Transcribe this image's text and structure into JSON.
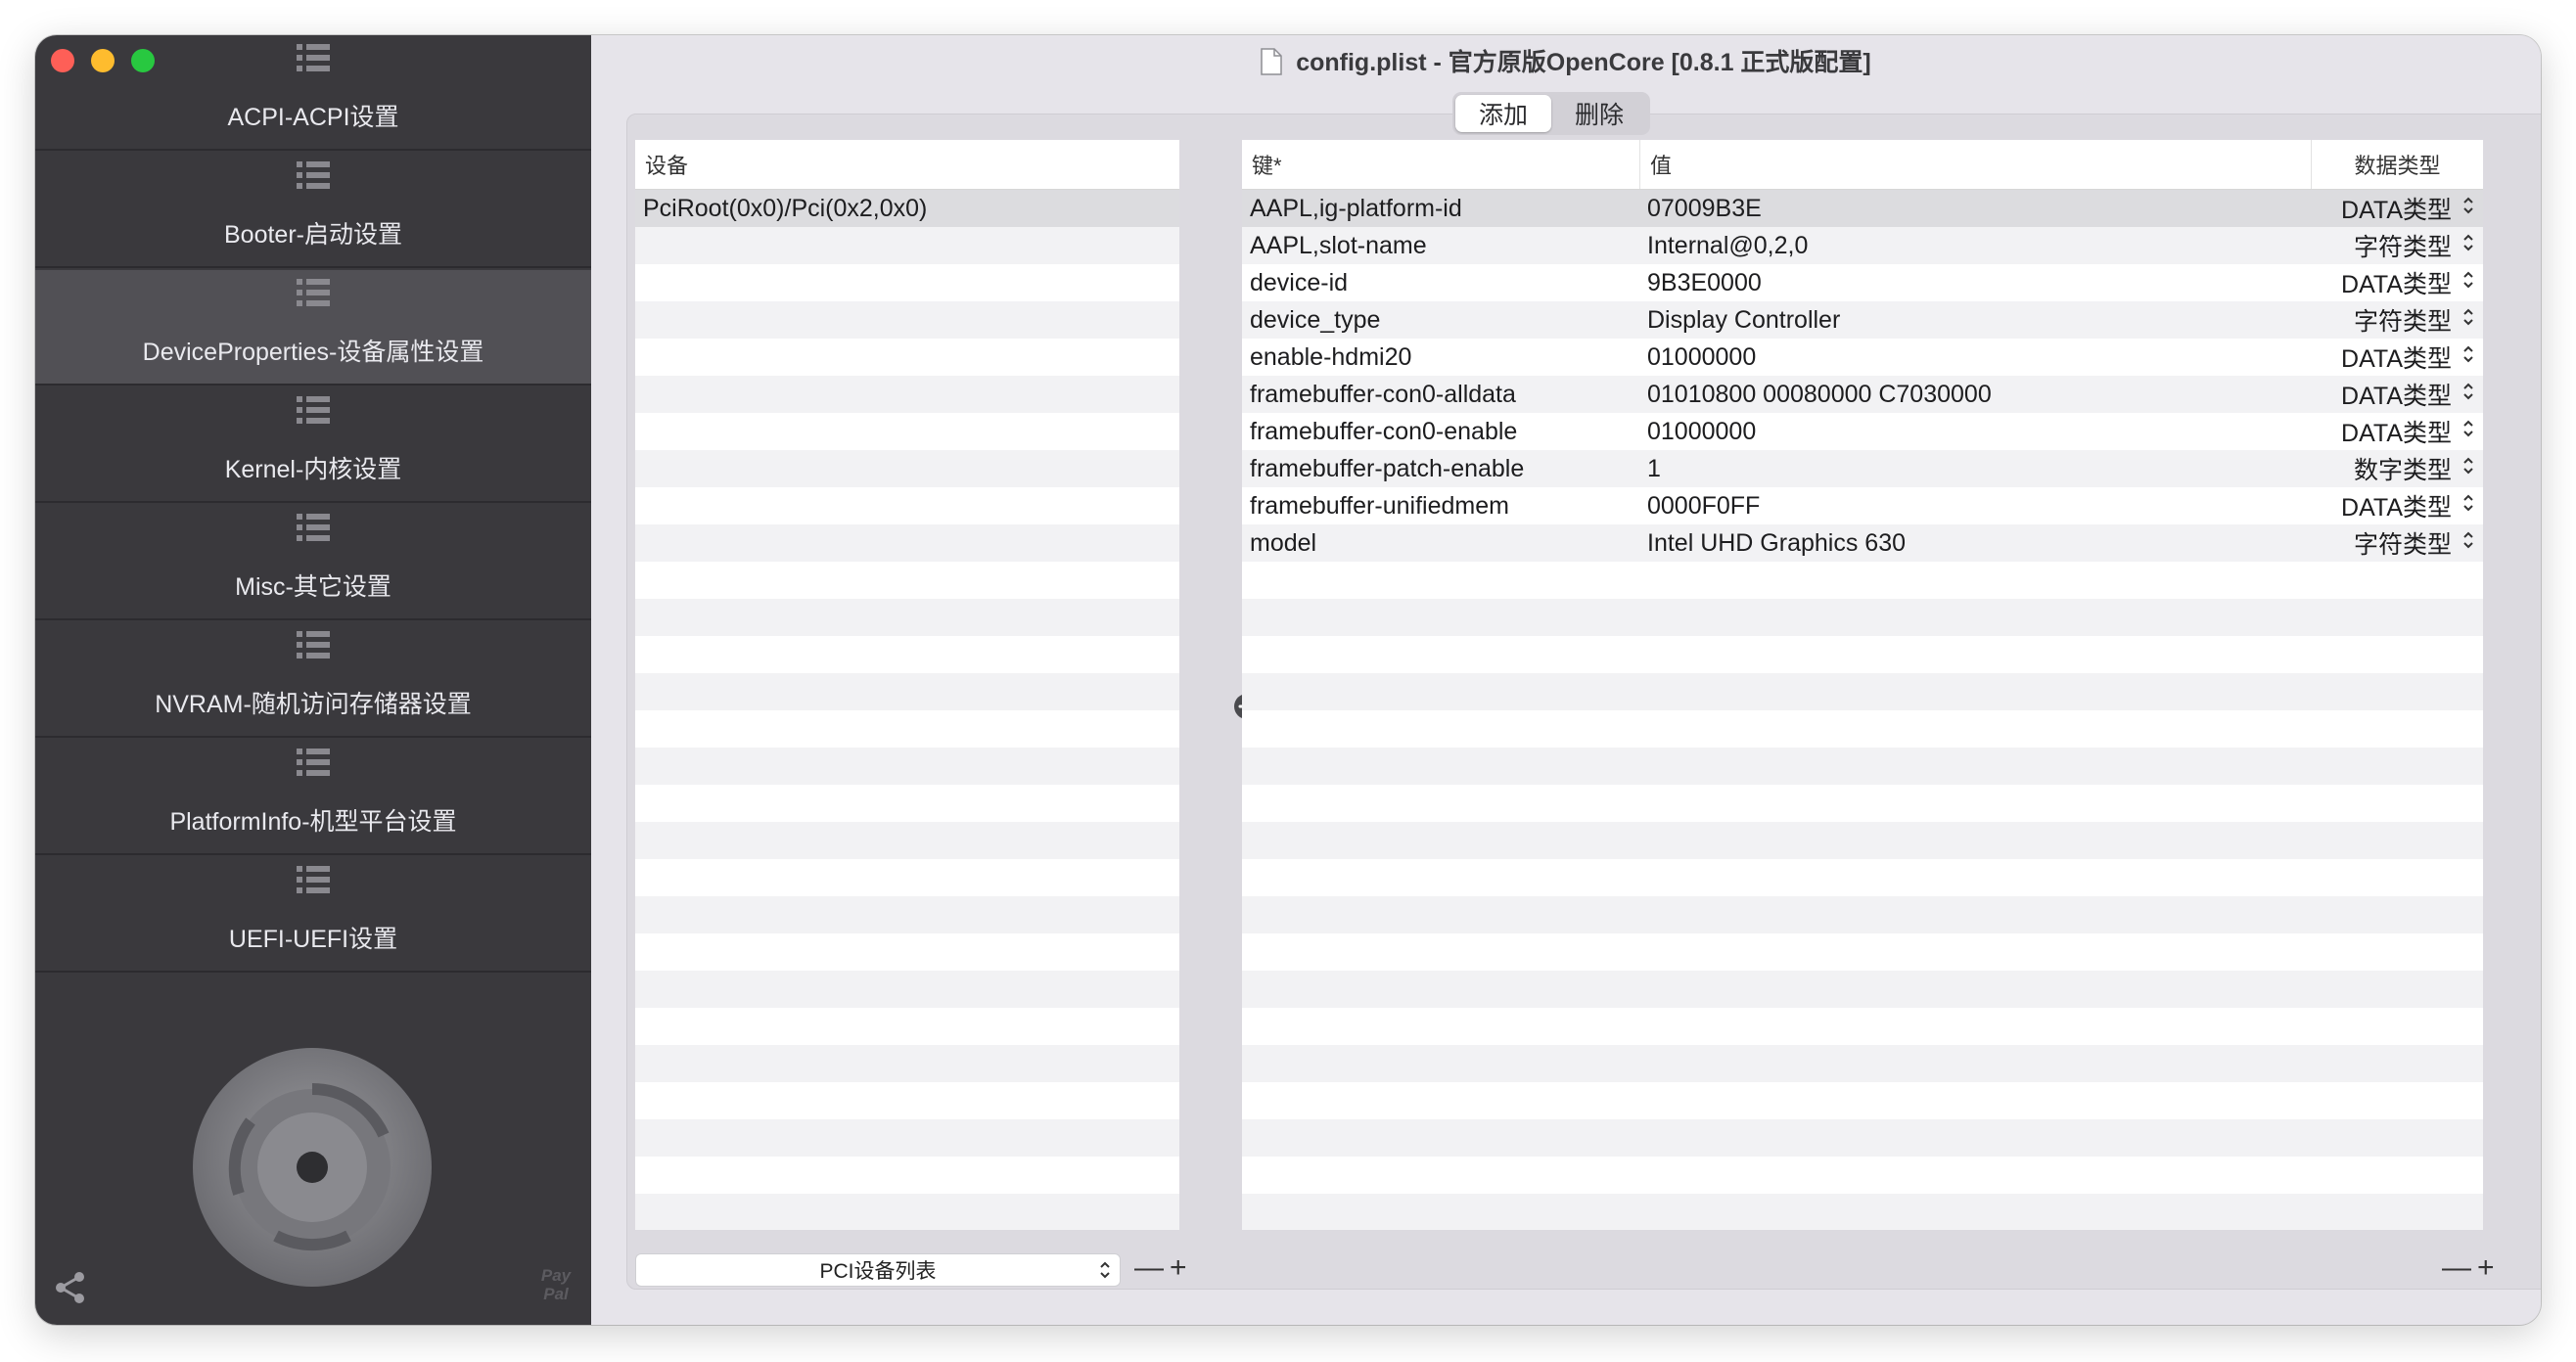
{
  "window": {
    "title": "config.plist - 官方原版OpenCore [0.8.1 正式版配置]"
  },
  "sidebar": {
    "items": [
      {
        "label": "ACPI-ACPI设置",
        "icon": "list-icon",
        "active": false
      },
      {
        "label": "Booter-启动设置",
        "icon": "list-icon",
        "active": false
      },
      {
        "label": "DeviceProperties-设备属性设置",
        "icon": "list-icon",
        "active": true
      },
      {
        "label": "Kernel-内核设置",
        "icon": "list-icon",
        "active": false
      },
      {
        "label": "Misc-其它设置",
        "icon": "list-icon",
        "active": false
      },
      {
        "label": "NVRAM-随机访问存储器设置",
        "icon": "list-icon",
        "active": false
      },
      {
        "label": "PlatformInfo-机型平台设置",
        "icon": "list-icon",
        "active": false
      },
      {
        "label": "UEFI-UEFI设置",
        "icon": "list-icon",
        "active": false
      }
    ],
    "paypal": "Pay\nPal"
  },
  "segmented": {
    "add": "添加",
    "delete": "删除",
    "selected": "添加"
  },
  "devices": {
    "header": "设备",
    "items": [
      "PciRoot(0x0)/Pci(0x2,0x0)"
    ],
    "selected_index": 0,
    "dropdown": "PCI设备列表"
  },
  "properties": {
    "headers": {
      "key": "键*",
      "value": "值",
      "type": "数据类型"
    },
    "rows": [
      {
        "key": "AAPL,ig-platform-id",
        "value": "07009B3E",
        "type": "DATA类型"
      },
      {
        "key": "AAPL,slot-name",
        "value": "Internal@0,2,0",
        "type": "字符类型"
      },
      {
        "key": "device-id",
        "value": "9B3E0000",
        "type": "DATA类型"
      },
      {
        "key": "device_type",
        "value": "Display Controller",
        "type": "字符类型"
      },
      {
        "key": "enable-hdmi20",
        "value": "01000000",
        "type": "DATA类型"
      },
      {
        "key": "framebuffer-con0-alldata",
        "value": "01010800 00080000 C7030000",
        "type": "DATA类型"
      },
      {
        "key": "framebuffer-con0-enable",
        "value": "01000000",
        "type": "DATA类型"
      },
      {
        "key": "framebuffer-patch-enable",
        "value": "1",
        "type": "数字类型"
      },
      {
        "key": "framebuffer-unifiedmem",
        "value": "0000F0FF",
        "type": "DATA类型"
      },
      {
        "key": "model",
        "value": "Intel UHD Graphics 630",
        "type": "字符类型"
      }
    ],
    "selected_index": 0
  },
  "controls": {
    "minus": "—",
    "plus": "+"
  },
  "colors": {
    "sidebar_bg": "#3a393d",
    "sidebar_active": "#515055",
    "window_bg": "#e6e4ea"
  }
}
